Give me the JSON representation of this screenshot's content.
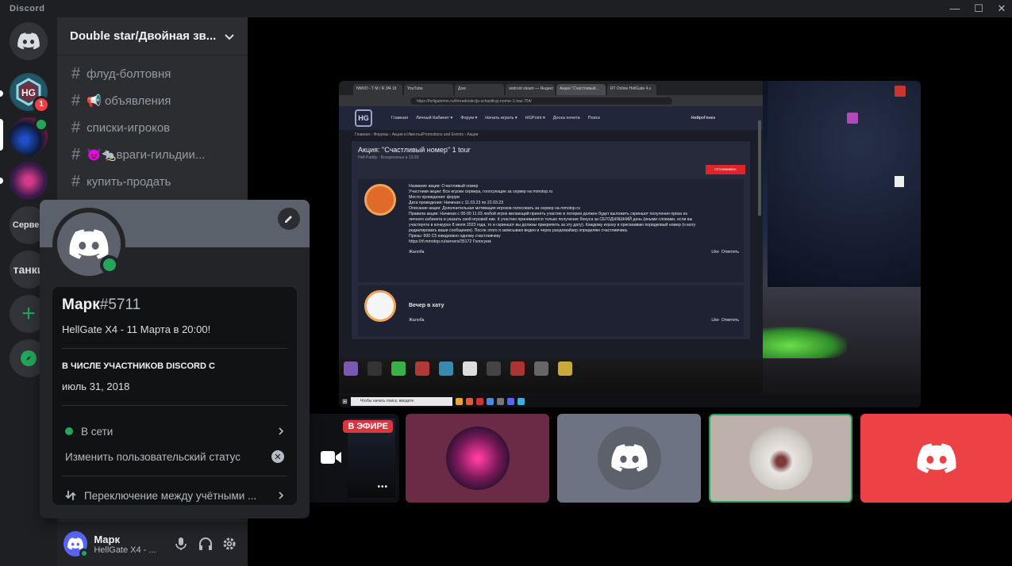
{
  "app": {
    "brand": "Discord"
  },
  "window_controls": {
    "minimize": "—",
    "maximize": "☐",
    "close": "✕"
  },
  "guilds": {
    "badge_count": "1",
    "text_server_1": "Сервер",
    "text_server_2": "танки"
  },
  "server": {
    "name": "Double star/Двойная зв...",
    "channels": [
      {
        "name": "флуд-болтовня"
      },
      {
        "name": "📢 объявления"
      },
      {
        "name": "списки-игроков"
      },
      {
        "name": "👿🐀враги-гильдии..."
      },
      {
        "name": "купить-продать"
      }
    ]
  },
  "user_panel": {
    "username": "Марк",
    "status": "HellGate X4 - ..."
  },
  "profile_popout": {
    "username": "Марк",
    "discriminator": "#5711",
    "custom_status": "HellGate X4 - 11 Марта в 20:00!",
    "member_since_label": "В ЧИСЛЕ УЧАСТНИКОВ DISCORD С",
    "member_since_date": "июль 31, 2018",
    "presence": "В сети",
    "change_status": "Изменить пользовательский статус",
    "switch_accounts": "Переключение между учётными ..."
  },
  "stream": {
    "browser_tabs": [
      "NMVD - T M / R 3f4 1ll",
      "YouTube",
      "Дом",
      "android steam — Яндекс",
      "Акция \"Счастливый...",
      "RT Online HellGate 4.x"
    ],
    "url": "https://hellgatemm.ru/threads/akcija-schastlivyj-nomer-1-tour.754/",
    "nav_items": [
      "Главная",
      "Личный Кабинет ▾",
      "Форум ▾",
      "Начать играть ▾",
      "HGPoint ▾",
      "Доска почета",
      "Поиск"
    ],
    "site_user": "НейроГенез",
    "breadcrumbs": "Главная › Форумы › Акции и Ивенты/Promotions and Events › Акции",
    "topic_title": "Акция: \"Счастливый номер\" 1 tour",
    "topic_meta": "Hell Paddy · Воскресенье в 13:29",
    "subscribe_btn": "Отслеживать",
    "post1_lines": [
      "Название акции: Счастливый номер",
      "Участники акции: Все игроки сервера, голосующие за сервер на mmotop.ru",
      "Место проведения: форум",
      "Дата проведения: Начиная с 11.03.23 по 22.03.23",
      "Описание акции: Дополнительная мотивация игроков голосовать за сервер на mmotop.ru",
      "Правила акции: Начиная с 00-00 11.03 любой игрок желающий принять участие в лотереи должен будет выложить скриншот получения приза из",
      "личного кабинета и указать свой игровой ник. К участию принимаются только получение бонуса за СЕГОДНЯШНИЙ день (иными словами, если вы",
      "участвуете в конкурсе 8 июля 2023 года, то и скриншот вы должны прикрепить за эту дату). Каждому игроку в присваиваю порядковый номер (я могу",
      "редактировать ваши сообщения). После этого я записываю видео и через рандомайзер определяю счастливчика.",
      "Призы: 600 С5 ежедневно одному счастливчику",
      "https://rf.mmotop.ru/servers/35172 Голосуем"
    ],
    "post2_text": "Вечер в хату",
    "report": "Жалоба",
    "like": "Like",
    "reply": "Ответить",
    "taskbar_search": "Чтобы начать поиск, введите"
  },
  "tiles": {
    "live_label": "В ЭФИРЕ",
    "more": "•••"
  },
  "colors": {
    "accent": "#5865f2",
    "online": "#23a55a",
    "live": "#da373c",
    "tile_red": "#ed4245",
    "tile_purple": "#6b2a45",
    "tile_gray": "#6d7382",
    "tile_beige": "#beb1ac"
  }
}
